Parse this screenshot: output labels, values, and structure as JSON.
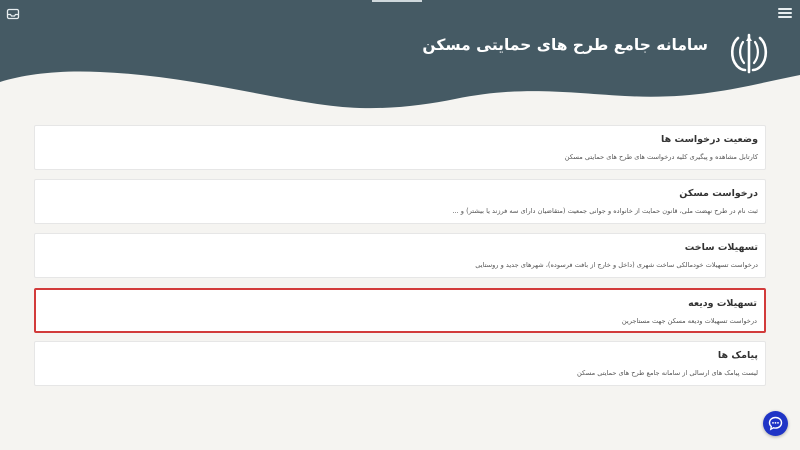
{
  "header": {
    "title": "سامانه جامع طرح های حمایتی مسکن",
    "colors": {
      "background": "#455a64",
      "text": "#ffffff"
    },
    "icons": {
      "menu": "hamburger-menu-icon",
      "inbox": "inbox-icon",
      "emblem": "iran-emblem-icon"
    }
  },
  "cards": [
    {
      "title": "وضعیت درخواست ها",
      "description": "کارتابل مشاهده و پیگیری کلیه درخواست های طرح های حمایتی مسکن"
    },
    {
      "title": "درخواست مسکن",
      "description": "ثبت نام در طرح نهضت ملی، قانون حمایت از خانواده و جوانی جمعیت (متقاضیان دارای سه فرزند یا بیشتر) و ..."
    },
    {
      "title": "تسهیلات ساخت",
      "description": "درخواست تسهیلات خودمالکی ساخت شهری (داخل و خارج از بافت فرسوده)، شهرهای جدید و روستایی"
    },
    {
      "title": "تسهیلات ودیعه",
      "description": "درخواست تسهیلات ودیعه مسکن جهت مستاجرین",
      "highlighted": true
    },
    {
      "title": "پیامک ها",
      "description": "لیست پیامک های ارسالی از سامانه جامع طرح های حمایتی مسکن"
    }
  ],
  "fab": {
    "icon": "chat-support-icon",
    "color": "#1f34c6"
  },
  "highlight_color": "#d23b3b"
}
